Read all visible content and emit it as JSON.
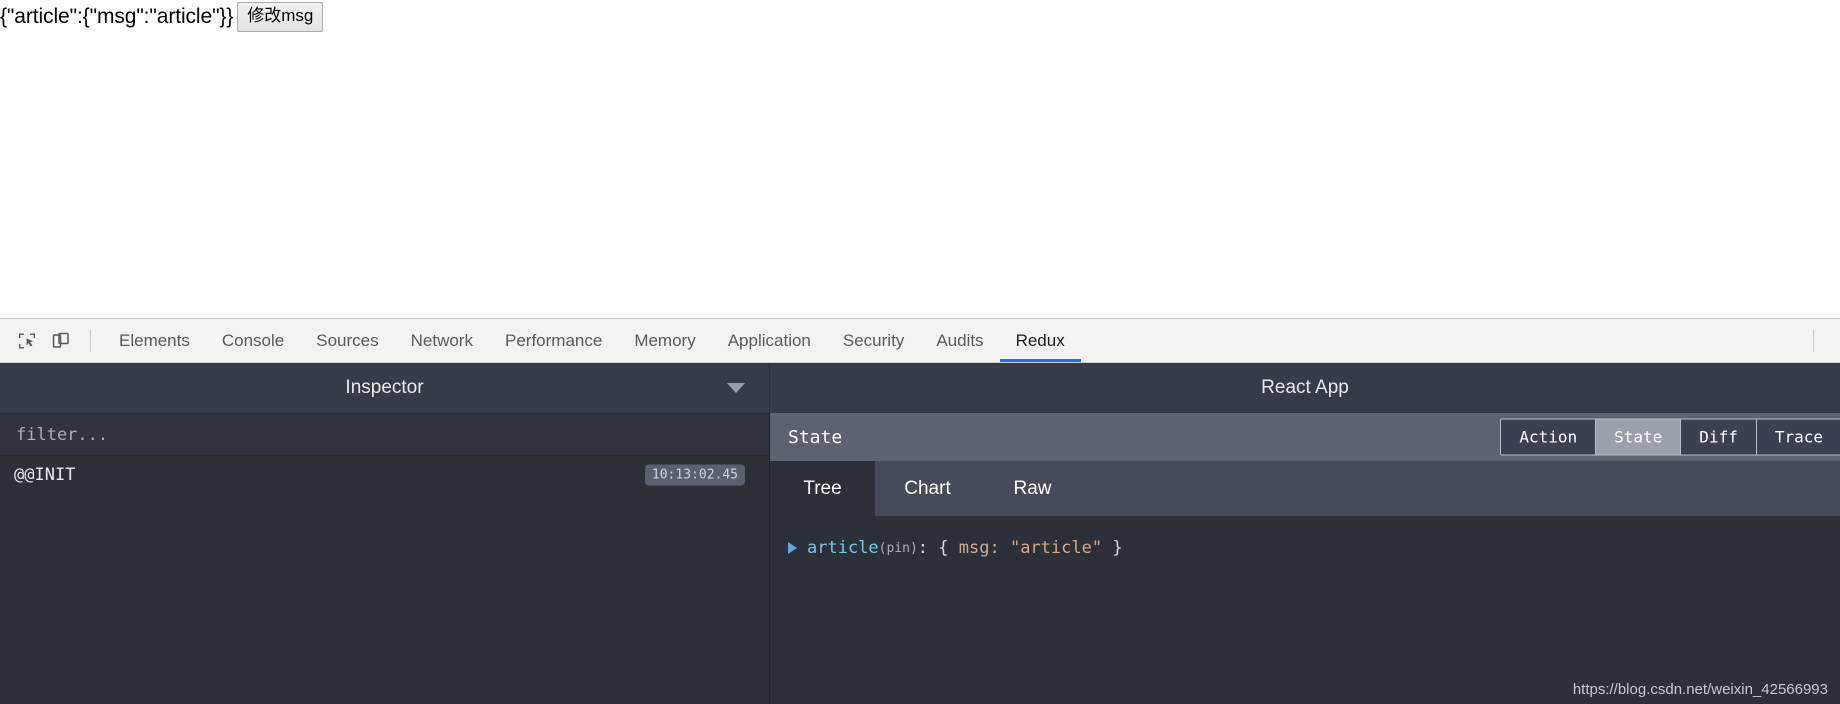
{
  "page": {
    "state_json": "{\"article\":{\"msg\":\"article\"}}",
    "modify_button_label": "修改msg"
  },
  "devtools": {
    "inspect_icon": "inspect-element-icon",
    "device_icon": "device-toolbar-icon",
    "tabs": [
      {
        "label": "Elements",
        "active": false
      },
      {
        "label": "Console",
        "active": false
      },
      {
        "label": "Sources",
        "active": false
      },
      {
        "label": "Network",
        "active": false
      },
      {
        "label": "Performance",
        "active": false
      },
      {
        "label": "Memory",
        "active": false
      },
      {
        "label": "Application",
        "active": false
      },
      {
        "label": "Security",
        "active": false
      },
      {
        "label": "Audits",
        "active": false
      },
      {
        "label": "Redux",
        "active": true
      }
    ],
    "accent_color": "#1a73e8"
  },
  "redux": {
    "inspector_title": "Inspector",
    "inspector_caret_icon": "chevron-down-icon",
    "instance_title": "React App",
    "filter": {
      "value": "",
      "placeholder": "filter..."
    },
    "actions": [
      {
        "name": "@@INIT",
        "time": "10:13:02.45",
        "selected": true
      }
    ],
    "state_bar_label": "State",
    "modes": [
      {
        "label": "Action",
        "active": false
      },
      {
        "label": "State",
        "active": true
      },
      {
        "label": "Diff",
        "active": false
      },
      {
        "label": "Trace",
        "active": false
      }
    ],
    "view_tabs": [
      {
        "label": "Tree",
        "active": true
      },
      {
        "label": "Chart",
        "active": false
      },
      {
        "label": "Raw",
        "active": false
      }
    ],
    "tree": {
      "arrow_icon": "triangle-right-icon",
      "key": "article",
      "pin": "(pin)",
      "colon": ": ",
      "open_brace": "{ ",
      "prop": "msg: ",
      "value": "\"article\"",
      "close_brace": " }"
    }
  },
  "watermark": "https://blog.csdn.net/weixin_42566993"
}
